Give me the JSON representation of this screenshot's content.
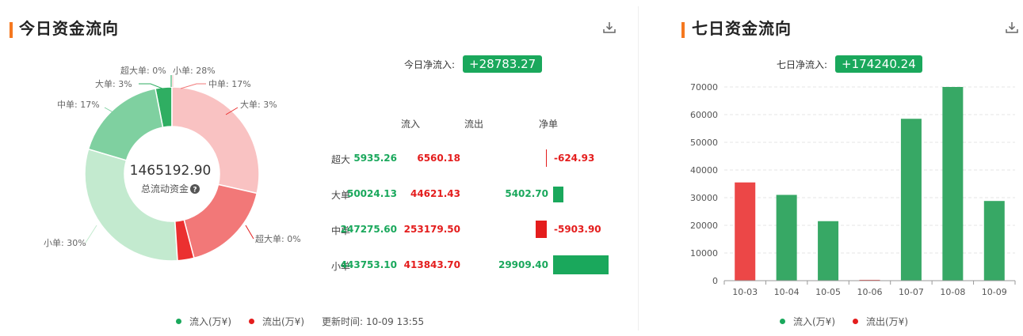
{
  "left": {
    "title": "今日资金流向",
    "net_label": "今日净流入:",
    "net_value": "+28783.27",
    "donut": {
      "center_value": "1465192.90",
      "center_label": "总流动资金",
      "help_icon": "question-circle-icon"
    },
    "table": {
      "headers": {
        "in": "流入",
        "out": "流出",
        "net": "净单"
      },
      "rows": [
        {
          "label": "超大",
          "in": "5935.26",
          "out": "6560.18",
          "net": "-624.93",
          "net_value": -624.93
        },
        {
          "label": "大单",
          "in": "50024.13",
          "out": "44621.43",
          "net": "5402.70",
          "net_value": 5402.7
        },
        {
          "label": "中单",
          "in": "247275.60",
          "out": "253179.50",
          "net": "-5903.90",
          "net_value": -5903.9
        },
        {
          "label": "小单",
          "in": "443753.10",
          "out": "413843.70",
          "net": "29909.40",
          "net_value": 29909.4
        }
      ]
    },
    "legend": {
      "inflow": "流入(万¥)",
      "outflow": "流出(万¥)",
      "updated": "更新时间: 10-09 13:55"
    },
    "download_icon": "download-icon"
  },
  "right": {
    "title": "七日资金流向",
    "net_label": "七日净流入:",
    "net_value": "+174240.24",
    "legend": {
      "inflow": "流入(万¥)",
      "outflow": "流出(万¥)"
    },
    "download_icon": "download-icon"
  },
  "colors": {
    "inflow": "#1aa85c",
    "outflow": "#e41d1d",
    "accent": "#f5781f"
  },
  "chart_data": [
    {
      "type": "pie",
      "donut": true,
      "slices": [
        {
          "label": "超大单: 0%",
          "value": 0,
          "side": "inflow",
          "color": "#1aa85c"
        },
        {
          "label": "大单: 3%",
          "value": 3,
          "side": "inflow",
          "color": "#2fae62"
        },
        {
          "label": "中单: 17%",
          "value": 17,
          "side": "inflow",
          "color": "#7fd0a0"
        },
        {
          "label": "小单: 30%",
          "value": 30,
          "side": "inflow",
          "color": "#c3eacf"
        },
        {
          "label": "小单: 28%",
          "value": 28,
          "side": "outflow",
          "color": "#f9c2c2"
        },
        {
          "label": "中单: 17%",
          "value": 17,
          "side": "outflow",
          "color": "#f27878"
        },
        {
          "label": "大单: 3%",
          "value": 3,
          "side": "outflow",
          "color": "#eb3030"
        },
        {
          "label": "超大单: 0%",
          "value": 0,
          "side": "outflow",
          "color": "#e41d1d"
        }
      ]
    },
    {
      "type": "bar",
      "categories": [
        "10-03",
        "10-04",
        "10-05",
        "10-06",
        "10-07",
        "10-08",
        "10-09"
      ],
      "values": [
        35500,
        31000,
        21500,
        300,
        58500,
        70000,
        28800
      ],
      "signs": [
        "outflow",
        "inflow",
        "inflow",
        "outflow",
        "inflow",
        "inflow",
        "inflow"
      ],
      "ylim": [
        0,
        70000
      ],
      "yticks": [
        "0",
        "10000",
        "20000",
        "30000",
        "40000",
        "50000",
        "60000",
        "70000"
      ],
      "grid": true,
      "legend": "bottom"
    }
  ]
}
